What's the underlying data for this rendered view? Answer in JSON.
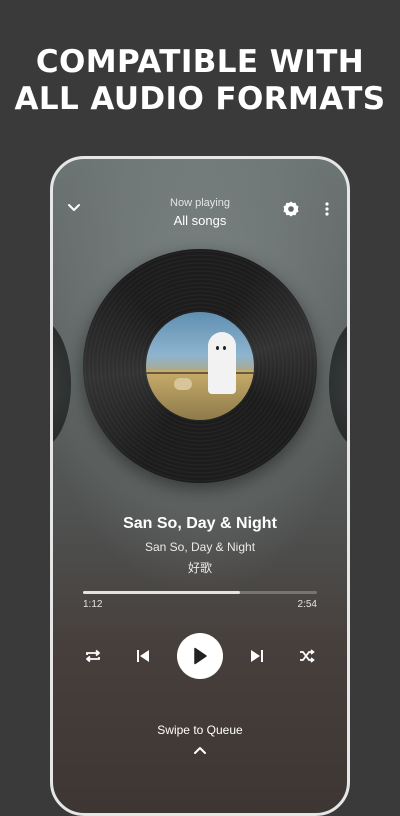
{
  "headline": {
    "line1": "COMPATIBLE WITH",
    "line2": "ALL AUDIO FORMATS"
  },
  "player": {
    "now_playing_label": "Now playing",
    "playlist": "All songs",
    "icons": {
      "collapse": "chevron-down-icon",
      "settings": "settings-icon",
      "more": "more-vertical-icon"
    }
  },
  "track": {
    "title": "San So, Day & Night",
    "artist": "San So, Day & Night",
    "album": "好歌",
    "elapsed": "1:12",
    "duration": "2:54",
    "progress_fraction": 0.67
  },
  "controls": {
    "repeat": "repeat-icon",
    "previous": "skip-previous-icon",
    "play": "play-icon",
    "next": "skip-next-icon",
    "shuffle": "shuffle-icon"
  },
  "queue": {
    "label": "Swipe to Queue",
    "icon": "chevron-up-icon"
  },
  "colors": {
    "background": "#3a3a3a",
    "accent": "#ffffff"
  }
}
